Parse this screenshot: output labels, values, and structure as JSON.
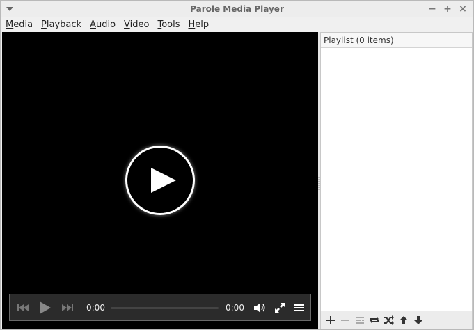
{
  "window": {
    "title": "Parole Media Player",
    "minimize_label": "−",
    "maximize_label": "+",
    "close_label": "×"
  },
  "menubar": {
    "items": [
      {
        "first": "M",
        "rest": "edia"
      },
      {
        "first": "P",
        "rest": "layback"
      },
      {
        "first": "A",
        "rest": "udio"
      },
      {
        "first": "V",
        "rest": "ideo"
      },
      {
        "first": "T",
        "rest": "ools"
      },
      {
        "first": "H",
        "rest": "elp"
      }
    ]
  },
  "player": {
    "current_time": "0:00",
    "total_time": "0:00",
    "progress": 0
  },
  "playlist": {
    "header": "Playlist (0 items)"
  },
  "icons": {
    "play_big": "play-icon",
    "prev": "skip-previous-icon",
    "play": "play-icon",
    "next": "skip-next-icon",
    "volume": "volume-icon",
    "fullscreen": "fullscreen-icon",
    "menu": "hamburger-menu-icon",
    "add": "plus-icon",
    "remove": "minus-icon",
    "clear": "clear-list-icon",
    "repeat": "repeat-icon",
    "shuffle": "shuffle-icon",
    "move_up": "arrow-up-icon",
    "move_down": "arrow-down-icon"
  }
}
